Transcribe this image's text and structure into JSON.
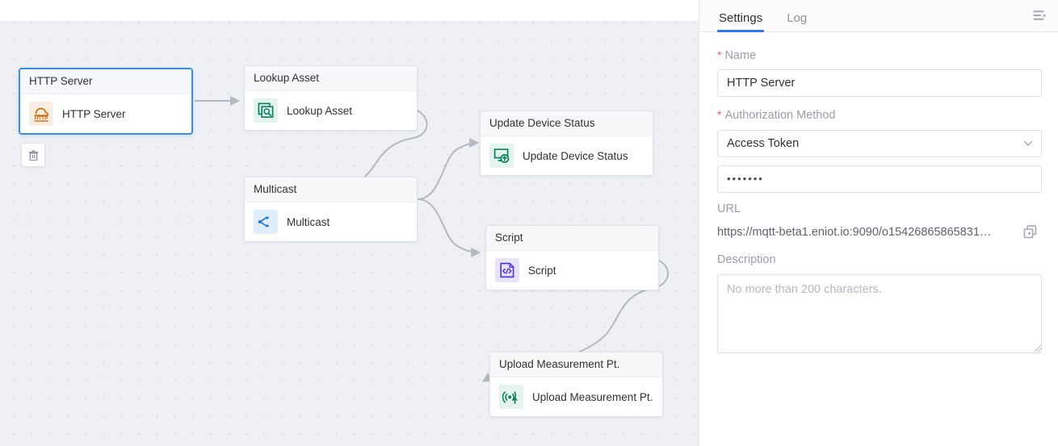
{
  "canvas": {
    "nodes": [
      {
        "id": "http-server",
        "title": "HTTP Server",
        "label": "HTTP Server",
        "icon": "http-cloud-icon",
        "selected": true
      },
      {
        "id": "lookup-asset",
        "title": "Lookup Asset",
        "label": "Lookup Asset",
        "icon": "lookup-asset-icon",
        "selected": false
      },
      {
        "id": "multicast",
        "title": "Multicast",
        "label": "Multicast",
        "icon": "multicast-icon",
        "selected": false
      },
      {
        "id": "update-device-status",
        "title": "Update Device Status",
        "label": "Update Device Status",
        "icon": "update-device-status-icon",
        "selected": false
      },
      {
        "id": "script",
        "title": "Script",
        "label": "Script",
        "icon": "script-icon",
        "selected": false
      },
      {
        "id": "upload-measurement",
        "title": "Upload Measurement Pt.",
        "label": "Upload Measurement Pt.",
        "icon": "upload-measurement-icon",
        "selected": false
      }
    ],
    "delete_button": "delete-node-button"
  },
  "panel": {
    "tabs": [
      {
        "label": "Settings",
        "active": true
      },
      {
        "label": "Log",
        "active": false
      }
    ],
    "collapse_icon": "collapse-panel-icon",
    "fields": {
      "name": {
        "label": "Name",
        "required": true,
        "value": "HTTP Server"
      },
      "authorization_method": {
        "label": "Authorization Method",
        "required": true,
        "value": "Access Token",
        "token_value": "•••••••"
      },
      "url": {
        "label": "URL",
        "value": "https://mqtt-beta1.eniot.io:9090/o15426865865831…",
        "copy_icon": "copy-icon"
      },
      "description": {
        "label": "Description",
        "value": "",
        "placeholder": "No more than 200 characters."
      }
    }
  },
  "colors": {
    "accent": "#2d79f3",
    "selected_node_border": "#3a8ee6",
    "highlight_box": "#f8443c",
    "required_star": "#f05a5a",
    "canvas_bg": "#eef0f4"
  }
}
